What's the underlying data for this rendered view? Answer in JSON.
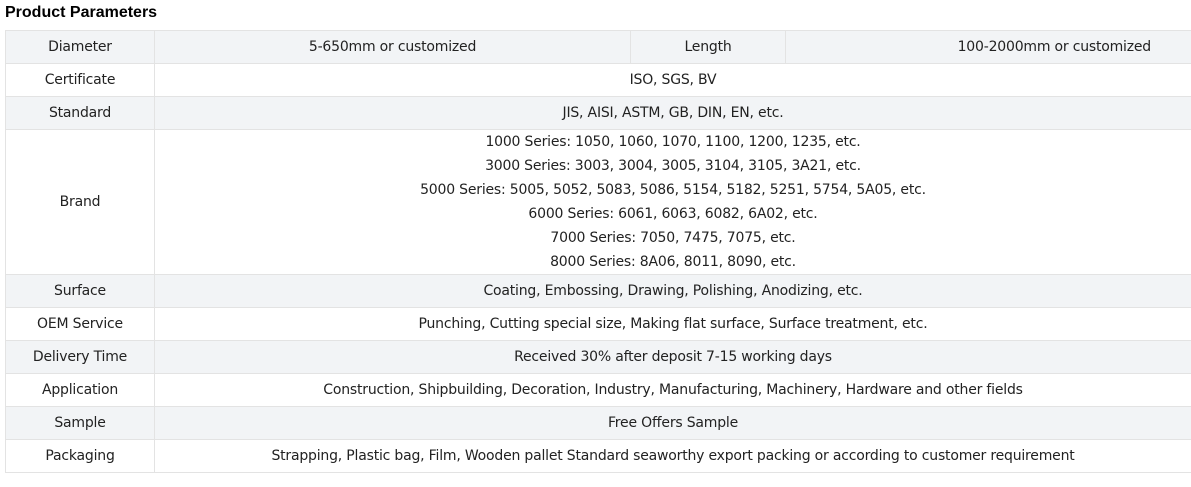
{
  "title": "Product Parameters",
  "rows": {
    "diameter": {
      "label": "Diameter",
      "value": "5-650mm or customized"
    },
    "length": {
      "label": "Length",
      "value": "100-2000mm or customized"
    },
    "certificate": {
      "label": "Certificate",
      "value": "ISO, SGS, BV"
    },
    "standard": {
      "label": "Standard",
      "value": "JIS, AISI, ASTM, GB, DIN, EN, etc."
    },
    "brand": {
      "label": "Brand",
      "lines": [
        "1000 Series: 1050, 1060, 1070, 1100, 1200, 1235, etc.",
        "3000 Series: 3003, 3004, 3005, 3104, 3105, 3A21, etc.",
        "5000 Series: 5005, 5052, 5083, 5086, 5154, 5182, 5251, 5754, 5A05, etc.",
        "6000 Series: 6061, 6063, 6082, 6A02, etc.",
        "7000 Series: 7050, 7475, 7075, etc.",
        "8000 Series: 8A06, 8011, 8090, etc."
      ]
    },
    "surface": {
      "label": "Surface",
      "value": "Coating, Embossing, Drawing, Polishing, Anodizing, etc."
    },
    "oem": {
      "label": "OEM Service",
      "value": "Punching, Cutting special size, Making flat surface, Surface treatment, etc."
    },
    "delivery": {
      "label": "Delivery Time",
      "value": "Received 30% after deposit 7-15 working days"
    },
    "application": {
      "label": "Application",
      "value": "Construction, Shipbuilding, Decoration, Industry, Manufacturing, Machinery, Hardware and other fields"
    },
    "sample": {
      "label": "Sample",
      "value": "Free Offers Sample"
    },
    "packaging": {
      "label": "Packaging",
      "value": "Strapping, Plastic bag, Film, Wooden pallet Standard seaworthy export packing or according to customer requirement"
    }
  },
  "colors": {
    "alt_row_bg": "#f2f4f6",
    "border": "#e3e3e3",
    "text": "#222222"
  }
}
